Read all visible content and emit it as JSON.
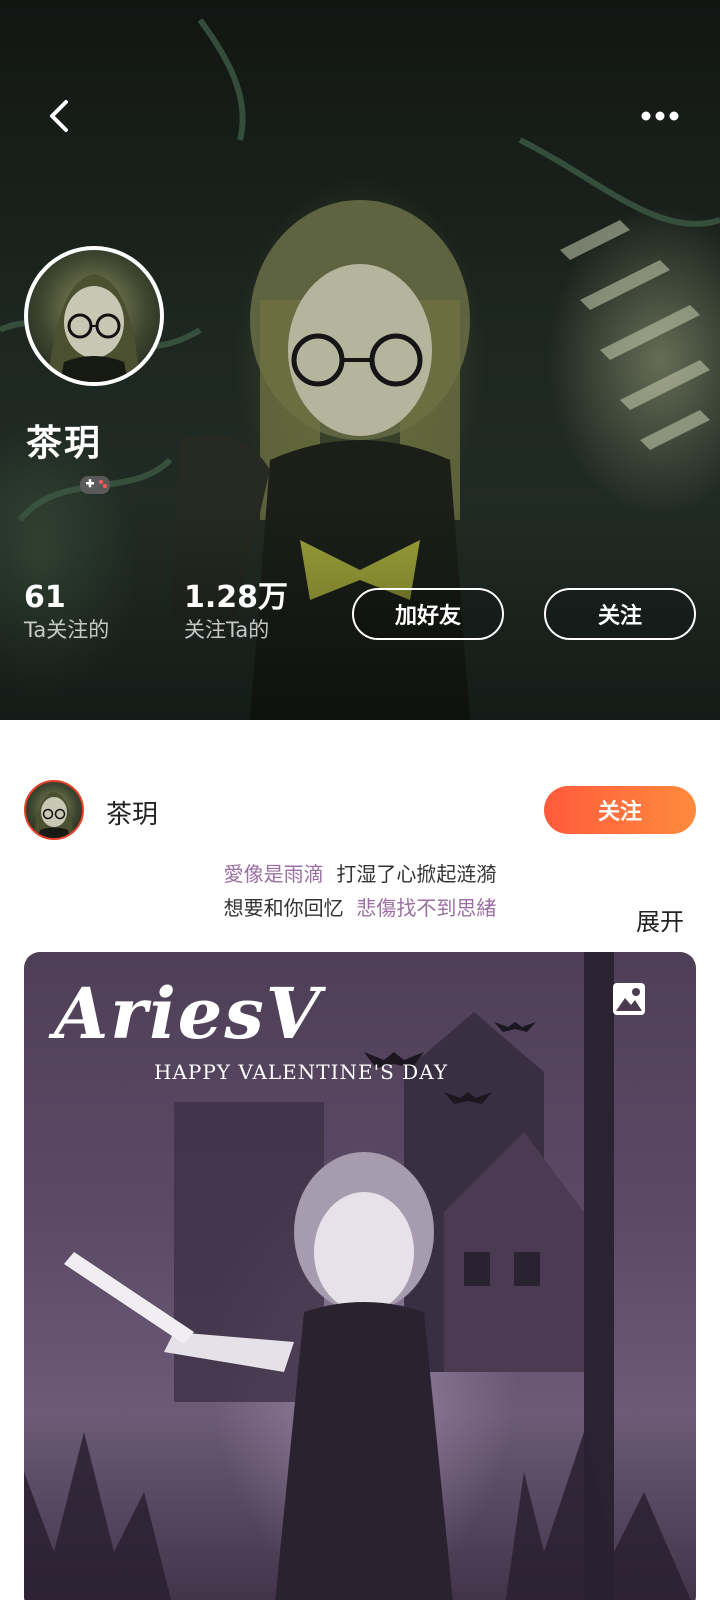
{
  "profile": {
    "name": "茶玥",
    "following_count": "61",
    "following_label": "Ta关注的",
    "followers_count": "1.28万",
    "followers_label": "关注Ta的",
    "add_friend_label": "加好友",
    "follow_label": "关注",
    "badge_icon": "gamepad-icon"
  },
  "header": {
    "back_icon": "chevron-left-icon",
    "more_icon": "more-dots-icon"
  },
  "post": {
    "author": "茶玥",
    "follow_label": "关注",
    "caption": {
      "line1_a": "愛像是雨滴",
      "line1_b": "打湿了心掀起涟漪",
      "line2_a": "想要和你回忆",
      "line2_b": "悲傷找不到思緒"
    },
    "expand_label": "展开",
    "image_title": "AriesV",
    "image_subtitle": "HAPPY VALENTINE'S DAY",
    "image_type_icon": "image-icon"
  },
  "colors": {
    "accent_orange": "#ff6a3c",
    "caption_purple": "#9b6fa3"
  }
}
